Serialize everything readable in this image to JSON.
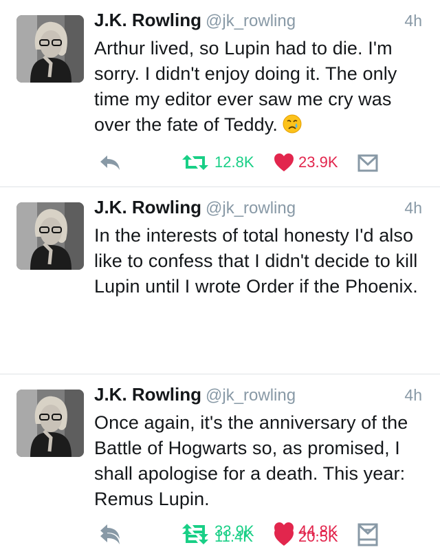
{
  "tweets": [
    {
      "name": "J.K. Rowling",
      "handle": "@jk_rowling",
      "time": "4h",
      "text": "Arthur lived, so Lupin had to die. I'm sorry. I didn't enjoy doing it. The only time my editor ever saw me cry was over the fate of Teddy.",
      "emoji": "crying-face-icon",
      "retweets": "12.8K",
      "likes": "23.9K"
    },
    {
      "name": "J.K. Rowling",
      "handle": "@jk_rowling",
      "time": "4h",
      "text": "In the interests of total honesty I'd also like to confess that I didn't decide to kill Lupin until I wrote Order if the Phoenix.",
      "retweets": "11.4K",
      "likes": "20.5K"
    },
    {
      "name": "J.K. Rowling",
      "handle": "@jk_rowling",
      "time": "4h",
      "text": "Once again, it's the anniversary of the Battle of Hogwarts so, as promised, I shall apologise for a death. This year: Remus Lupin.",
      "retweets": "33.9K",
      "likes": "44.8K"
    }
  ],
  "colors": {
    "retweet": "#19cf86",
    "like": "#e2264d",
    "icon_gray": "#8899a6",
    "text": "#14171a"
  }
}
